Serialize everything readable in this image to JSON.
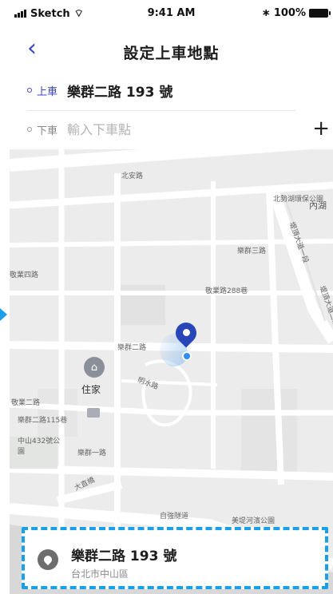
{
  "status_bar": {
    "carrier": "Sketch",
    "time": "9:41 AM",
    "battery": "100%"
  },
  "header": {
    "back_label": "‹",
    "title": "設定上車地點"
  },
  "pickup": {
    "tag": "上車",
    "value": "樂群二路 193 號"
  },
  "dropoff": {
    "tag": "下車",
    "placeholder": "輸入下車點",
    "add_label": "+"
  },
  "map": {
    "labels": [
      "北安路",
      "北勢湖環保公園",
      "內湖",
      "堤頂大道一段",
      "樂群三路",
      "敬業路288巷",
      "樂群二路",
      "明水路",
      "中山432號公園",
      "樂群一路",
      "美堤河濱公園",
      "大直橋",
      "自強隧道",
      "堤頂大道二段",
      "敬業二路",
      "樂群二路115巷",
      "敬業四路"
    ],
    "home_label": "住家"
  },
  "result_card": {
    "title": "樂群二路 193 號",
    "subtitle": "台北市中山區"
  },
  "colors": {
    "accent": "#3b47c4",
    "pin": "#2846b8",
    "highlight": "#1aa0e8"
  }
}
